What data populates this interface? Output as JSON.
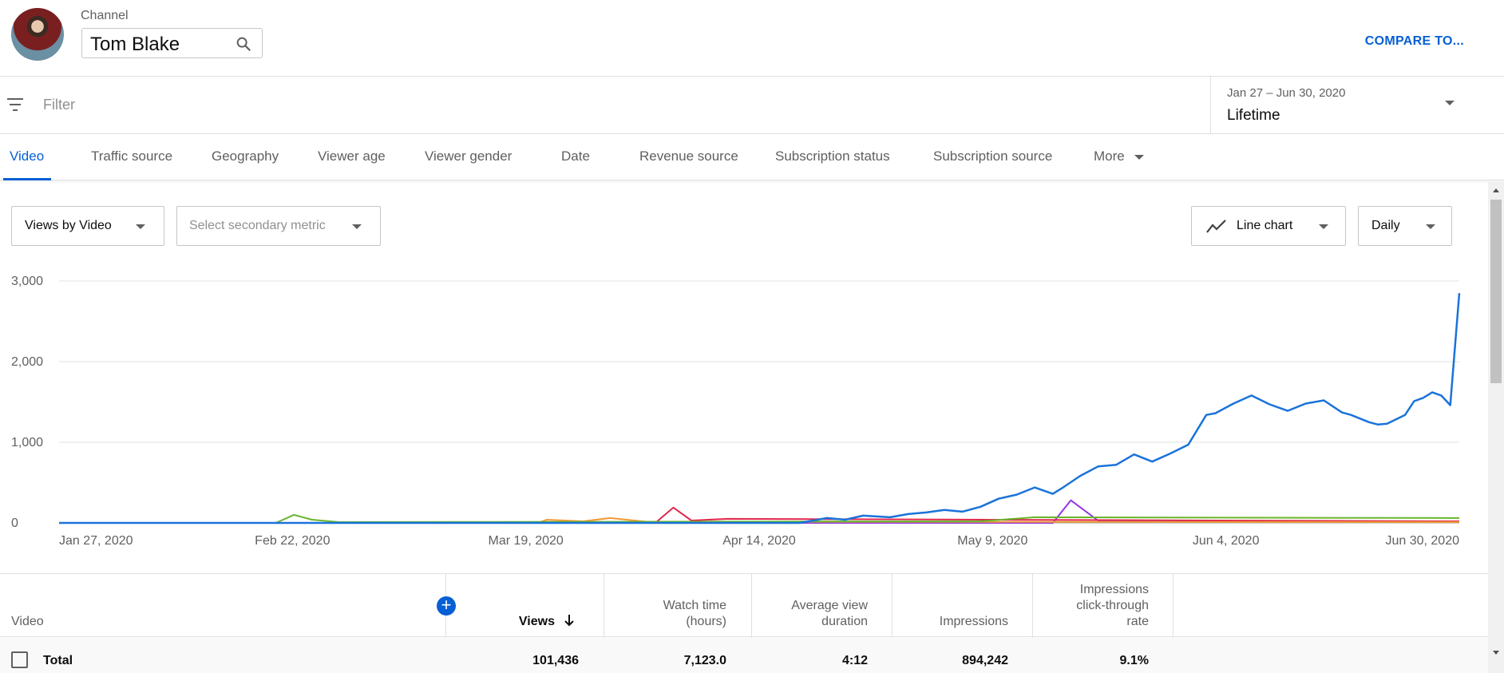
{
  "header": {
    "channel_label": "Channel",
    "channel_name": "Tom Blake",
    "compare_label": "COMPARE TO..."
  },
  "filterbar": {
    "placeholder": "Filter",
    "date_range": "Jan 27 – Jun 30, 2020",
    "date_value": "Lifetime"
  },
  "tabs": [
    {
      "label": "Video",
      "active": true
    },
    {
      "label": "Traffic source"
    },
    {
      "label": "Geography"
    },
    {
      "label": "Viewer age"
    },
    {
      "label": "Viewer gender"
    },
    {
      "label": "Date"
    },
    {
      "label": "Revenue source"
    },
    {
      "label": "Subscription status"
    },
    {
      "label": "Subscription source"
    },
    {
      "label": "More"
    }
  ],
  "controls": {
    "primary_metric": "Views by Video",
    "secondary_metric": "Select secondary metric",
    "chart_type": "Line chart",
    "interval": "Daily"
  },
  "colors": {
    "accent": "#065fd4",
    "series_blue": "#1a73d9",
    "series_green": "#68b52b",
    "series_orange": "#f09a36",
    "series_red": "#e0294d",
    "series_purple": "#9334e6"
  },
  "chart_data": {
    "type": "line",
    "xlabel": "",
    "ylabel": "",
    "ylim": [
      0,
      3000
    ],
    "yticks": [
      0,
      1000,
      2000,
      3000
    ],
    "ytick_labels": [
      "0",
      "1,000",
      "2,000",
      "3,000"
    ],
    "xtick_labels": [
      "Jan 27, 2020",
      "Feb 22, 2020",
      "Mar 19, 2020",
      "Apr 14, 2020",
      "May 9, 2020",
      "Jun 4, 2020",
      "Jun 30, 2020"
    ],
    "x_start": "2020-01-27",
    "x_end": "2020-06-30",
    "grid": true,
    "series": [
      {
        "color": "#1a73d9",
        "points": [
          [
            "2020-01-27",
            0
          ],
          [
            "2020-04-18",
            0
          ],
          [
            "2020-04-21",
            60
          ],
          [
            "2020-04-23",
            40
          ],
          [
            "2020-04-25",
            90
          ],
          [
            "2020-04-28",
            70
          ],
          [
            "2020-04-30",
            110
          ],
          [
            "2020-05-02",
            130
          ],
          [
            "2020-05-04",
            160
          ],
          [
            "2020-05-06",
            140
          ],
          [
            "2020-05-08",
            200
          ],
          [
            "2020-05-10",
            300
          ],
          [
            "2020-05-12",
            350
          ],
          [
            "2020-05-14",
            440
          ],
          [
            "2020-05-16",
            360
          ],
          [
            "2020-05-17",
            430
          ],
          [
            "2020-05-19",
            580
          ],
          [
            "2020-05-21",
            700
          ],
          [
            "2020-05-23",
            720
          ],
          [
            "2020-05-25",
            850
          ],
          [
            "2020-05-27",
            760
          ],
          [
            "2020-05-29",
            860
          ],
          [
            "2020-05-31",
            970
          ],
          [
            "2020-06-02",
            1340
          ],
          [
            "2020-06-03",
            1360
          ],
          [
            "2020-06-05",
            1480
          ],
          [
            "2020-06-07",
            1580
          ],
          [
            "2020-06-09",
            1470
          ],
          [
            "2020-06-11",
            1390
          ],
          [
            "2020-06-13",
            1480
          ],
          [
            "2020-06-15",
            1520
          ],
          [
            "2020-06-17",
            1370
          ],
          [
            "2020-06-18",
            1340
          ],
          [
            "2020-06-20",
            1250
          ],
          [
            "2020-06-21",
            1220
          ],
          [
            "2020-06-22",
            1230
          ],
          [
            "2020-06-24",
            1340
          ],
          [
            "2020-06-25",
            1510
          ],
          [
            "2020-06-26",
            1550
          ],
          [
            "2020-06-27",
            1620
          ],
          [
            "2020-06-28",
            1580
          ],
          [
            "2020-06-29",
            1460
          ],
          [
            "2020-06-30",
            2850
          ]
        ]
      },
      {
        "color": "#68b52b",
        "points": [
          [
            "2020-01-27",
            0
          ],
          [
            "2020-02-20",
            0
          ],
          [
            "2020-02-22",
            100
          ],
          [
            "2020-02-24",
            40
          ],
          [
            "2020-02-27",
            10
          ],
          [
            "2020-05-08",
            20
          ],
          [
            "2020-05-14",
            70
          ],
          [
            "2020-06-30",
            60
          ]
        ]
      },
      {
        "color": "#f09a36",
        "points": [
          [
            "2020-01-27",
            0
          ],
          [
            "2020-03-20",
            0
          ],
          [
            "2020-03-21",
            40
          ],
          [
            "2020-03-25",
            20
          ],
          [
            "2020-03-28",
            60
          ],
          [
            "2020-04-01",
            15
          ],
          [
            "2020-06-30",
            10
          ]
        ]
      },
      {
        "color": "#e0294d",
        "points": [
          [
            "2020-01-27",
            0
          ],
          [
            "2020-04-02",
            0
          ],
          [
            "2020-04-04",
            190
          ],
          [
            "2020-04-06",
            30
          ],
          [
            "2020-04-10",
            50
          ],
          [
            "2020-06-30",
            20
          ]
        ]
      },
      {
        "color": "#9334e6",
        "points": [
          [
            "2020-01-27",
            0
          ],
          [
            "2020-05-16",
            0
          ],
          [
            "2020-05-18",
            280
          ],
          [
            "2020-05-21",
            30
          ],
          [
            "2020-06-30",
            10
          ]
        ]
      }
    ]
  },
  "table": {
    "columns": [
      {
        "label": "Video"
      },
      {
        "label": "Views",
        "sorted": true
      },
      {
        "label": "Watch time\n(hours)"
      },
      {
        "label": "Average view\nduration"
      },
      {
        "label": "Impressions"
      },
      {
        "label": "Impressions\nclick-through\nrate"
      }
    ],
    "total": {
      "label": "Total",
      "views": "101,436",
      "watch_time": "7,123.0",
      "avg_view_duration": "4:12",
      "impressions": "894,242",
      "ctr": "9.1%"
    }
  }
}
